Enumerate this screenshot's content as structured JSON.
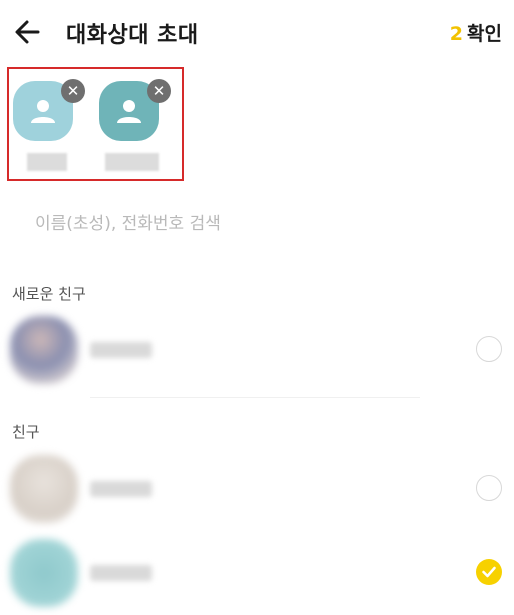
{
  "header": {
    "title": "대화상대 초대",
    "selected_count": "2",
    "confirm_label": "확인"
  },
  "selected": [
    {
      "remove": "✕"
    },
    {
      "remove": "✕"
    }
  ],
  "search": {
    "placeholder": "이름(초성), 전화번호 검색"
  },
  "sections": {
    "new_friends": "새로운 친구",
    "friends": "친구"
  },
  "friends": [
    {
      "checked": false
    },
    {
      "checked": false
    },
    {
      "checked": true
    }
  ],
  "colors": {
    "accent": "#f7d100",
    "highlight_border": "#d62a2a"
  }
}
